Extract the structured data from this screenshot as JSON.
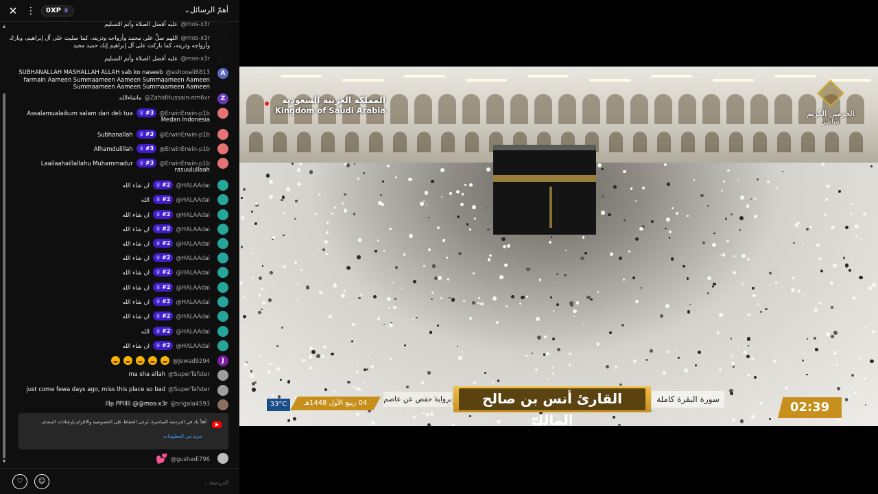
{
  "chat": {
    "title": "أهمّ الرسائل",
    "xp_badge": "0XP",
    "notice_text": "أهلاً بك في الدردشة المباشرة. يُرجى الحفاظ على الخصوصية والالتزام بإرشادات المنتدى.",
    "notice_link": "مزيد من المعلومات",
    "input_placeholder": "الدردشة...",
    "messages": [
      {
        "author": "@mos-x3r",
        "text": "عليه أفضل الصلاة وأتم التسليم",
        "avatar_color": "#111111"
      },
      {
        "author": "@mos-x3r",
        "text": "اللهم صلِّ على محمد وأزواجه وذريته، كما صليت على آل إبراهيم، وبارك على محمد",
        "cont": [
          "وأزواجه وذريته، كما باركت على آل إبراهيم إنك حميد مجيد"
        ],
        "avatar_color": "#111111"
      },
      {
        "author": "@mos-x3r",
        "text": "عليه أفضل الصلاة وأتم التسليم",
        "avatar_color": "#111111"
      },
      {
        "author": "@ashooali6813",
        "text": "SUBHANALLAH MASHALLAH ALLAH sab ko naseeb",
        "cont": [
          "farmain Aameen Summaameen Aameen Summaameen Aameen",
          "Summaameen Aameen Summaameen Aameen"
        ],
        "avatar_letter": "A",
        "avatar_color": "#5c6bc0"
      },
      {
        "author": "@ZahidHussain-nm6vr",
        "text": "ماشاءالله",
        "avatar_letter": "Z",
        "avatar_color": "#673ab7"
      },
      {
        "author": "@ErwinErwin-p1b",
        "badge": "#3",
        "text": "Assalamualaikum salam dari deli tua",
        "cont": [
          "Medan Indonesia"
        ],
        "avatar_color": "#e57373"
      },
      {
        "author": "@ErwinErwin-p1b",
        "badge": "#3",
        "text": "Subhanallah",
        "avatar_color": "#e57373"
      },
      {
        "author": "@ErwinErwin-p1b",
        "badge": "#3",
        "text": "Alhamdulillah",
        "avatar_color": "#e57373"
      },
      {
        "author": "@ErwinErwin-p1b",
        "badge": "#3",
        "text": "Laailaahaillallahu Muhammadur",
        "cont": [
          "rasuulullaah"
        ],
        "avatar_color": "#e57373"
      },
      {
        "author": "@HALAAdai",
        "badge": "#2",
        "text": "ان شاء الله",
        "avatar_color": "#26a69a"
      },
      {
        "author": "@HALAAdai",
        "badge": "#2",
        "text": "الله",
        "avatar_color": "#26a69a"
      },
      {
        "author": "@HALAAdai",
        "badge": "#2",
        "text": "ان شاء الله",
        "avatar_color": "#26a69a"
      },
      {
        "author": "@HALAAdai",
        "badge": "#2",
        "text": "ان شاء الله",
        "avatar_color": "#26a69a"
      },
      {
        "author": "@HALAAdai",
        "badge": "#2",
        "text": "ان شاء الله",
        "avatar_color": "#26a69a"
      },
      {
        "author": "@HALAAdai",
        "badge": "#2",
        "text": "ان شاء الله",
        "avatar_color": "#26a69a"
      },
      {
        "author": "@HALAAdai",
        "badge": "#2",
        "text": "ان شاء الله",
        "avatar_color": "#26a69a"
      },
      {
        "author": "@HALAAdai",
        "badge": "#2",
        "text": "ان شاء الله",
        "avatar_color": "#26a69a"
      },
      {
        "author": "@HALAAdai",
        "badge": "#2",
        "text": "ان شاء الله",
        "avatar_color": "#26a69a"
      },
      {
        "author": "@HALAAdai",
        "badge": "#2",
        "text": "ان شاء الله",
        "avatar_color": "#26a69a"
      },
      {
        "author": "@HALAAdai",
        "badge": "#2",
        "text": "الله",
        "avatar_color": "#26a69a"
      },
      {
        "author": "@HALAAdai",
        "badge": "#2",
        "text": "ان شاء الله",
        "avatar_color": "#26a69a"
      },
      {
        "author": "@Jewad9294",
        "emoji_count": 5,
        "text": "",
        "avatar_letter": "J",
        "avatar_color": "#7b1fa2"
      },
      {
        "author": "@SuperTafster",
        "text": "ma sha allah",
        "avatar_color": "#9e9e9e"
      },
      {
        "author": "@SuperTafster",
        "text": "just come fewa days ago, miss this place so bad",
        "avatar_color": "#9e9e9e"
      },
      {
        "author": "@srigala4593",
        "text": "lllp PPlllll @@mos-x3r",
        "avatar_color": "#8d6e63"
      },
      {
        "author": "@gushadi796",
        "heart": true,
        "text": "",
        "avatar_color": "#bdbdbd"
      }
    ]
  },
  "video": {
    "country_ar": "المملكة العربية السعودية",
    "country_en": "Kingdom of Saudi Arabia",
    "channel_name": "الحرمين الكريم",
    "channel_live": "مباشر",
    "reciter": "القارئ أنس بن صالح المالك",
    "surah": "سورة البقرة كاملة",
    "riwaya": "برواية حفص عن عاصم",
    "hijri_date": "04 ربيع الأول 1448هـ",
    "temperature": "33°C",
    "clock": "02:39"
  },
  "colors": {
    "chat_bg": "#0f0f0f",
    "badge_purple": "#3f1ec9",
    "gold": "#c7901c",
    "link_blue": "#3ea6ff",
    "youtube_red": "#ff0000"
  },
  "icons": {
    "close": "close-icon",
    "menu": "more-vert-icon",
    "chevron": "chevron-down-icon",
    "heart": "heart-icon",
    "emoji": "emoji-icon"
  }
}
